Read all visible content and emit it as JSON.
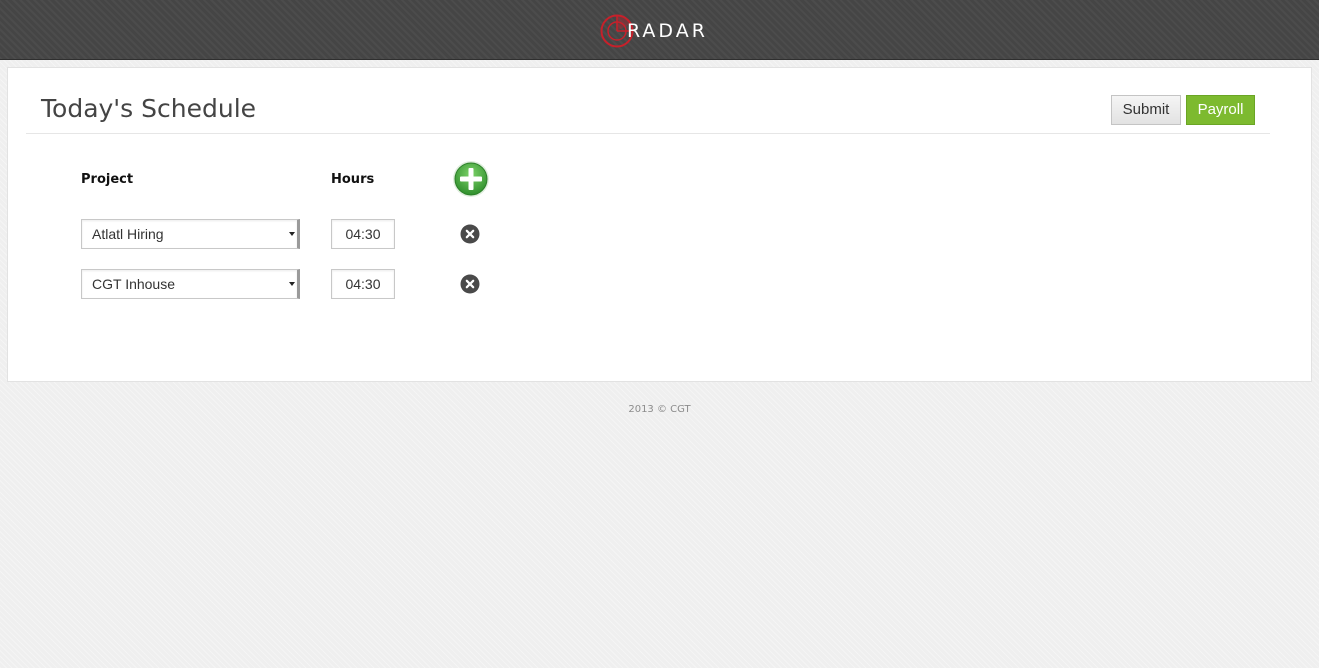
{
  "header": {
    "brand_name": "RADAR",
    "logo_icon": "radar-logo-icon",
    "accent_color": "#d0202a"
  },
  "main": {
    "title": "Today's Schedule",
    "buttons": {
      "submit_label": "Submit",
      "payroll_label": "Payroll"
    },
    "columns": {
      "project": "Project",
      "hours": "Hours"
    },
    "add_icon": "plus-circle-icon",
    "rows": [
      {
        "project": "Atlatl Hiring",
        "hours": "04:30",
        "remove_icon": "close-circle-icon"
      },
      {
        "project": "CGT Inhouse",
        "hours": "04:30",
        "remove_icon": "close-circle-icon"
      }
    ]
  },
  "colors": {
    "payroll_green": "#7dba2f",
    "add_green": "#43a33c",
    "topbar": "#454545"
  },
  "footer": {
    "text": "2013 © CGT"
  }
}
